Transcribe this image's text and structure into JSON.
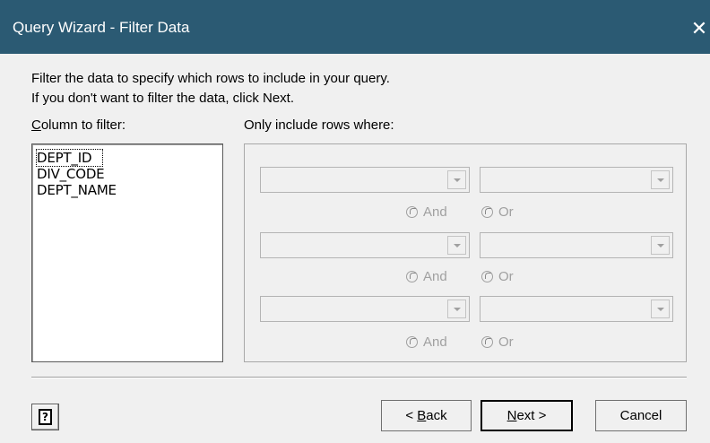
{
  "window": {
    "title": "Query Wizard - Filter Data",
    "close_glyph": "✕"
  },
  "instructions": {
    "line1": "Filter the data to specify which rows to include in your query.",
    "line2": "If you don't want to filter the data, click Next."
  },
  "column_label": {
    "accel": "C",
    "rest": "olumn to filter:"
  },
  "columns": [
    "DEPT_ID",
    "DIV_CODE",
    "DEPT_NAME"
  ],
  "filter_label": "Only include rows where:",
  "radios": {
    "and": "And",
    "or": "Or"
  },
  "buttons": {
    "help_glyph": "?",
    "back_prefix": "< ",
    "back_accel": "B",
    "back_rest": "ack",
    "next_accel": "N",
    "next_rest": "ext >",
    "cancel": "Cancel"
  }
}
